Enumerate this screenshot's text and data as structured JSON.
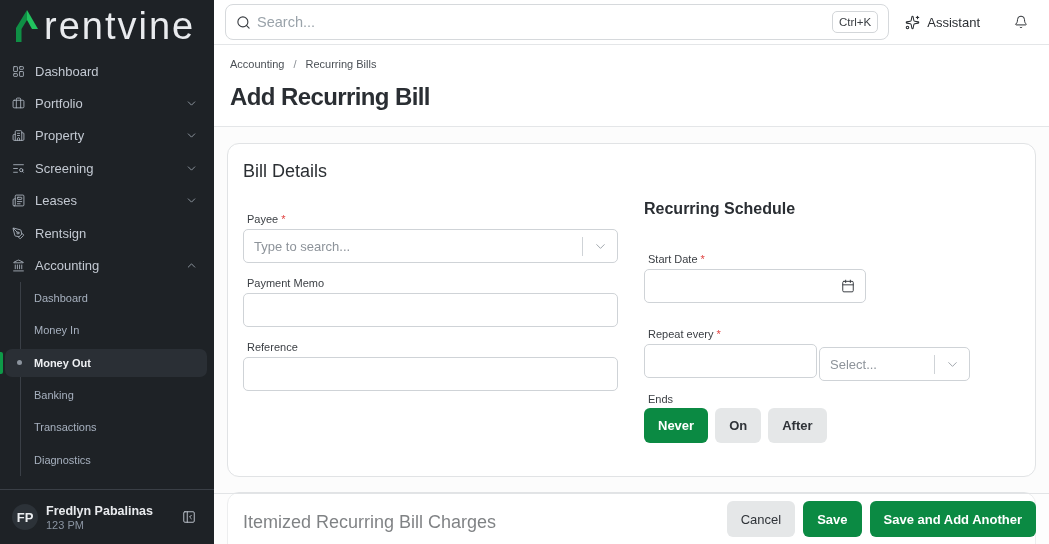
{
  "sidebar": {
    "logo": "rentvine",
    "items": [
      {
        "label": "Dashboard",
        "kind": "link"
      },
      {
        "label": "Portfolio",
        "kind": "group",
        "expanded": false
      },
      {
        "label": "Property",
        "kind": "group",
        "expanded": false
      },
      {
        "label": "Screening",
        "kind": "group",
        "expanded": false
      },
      {
        "label": "Leases",
        "kind": "group",
        "expanded": false
      },
      {
        "label": "Rentsign",
        "kind": "link"
      },
      {
        "label": "Accounting",
        "kind": "group",
        "expanded": true,
        "children": [
          {
            "label": "Dashboard",
            "selected": false
          },
          {
            "label": "Money In",
            "selected": false
          },
          {
            "label": "Money Out",
            "selected": true
          },
          {
            "label": "Banking",
            "selected": false
          },
          {
            "label": "Transactions",
            "selected": false
          },
          {
            "label": "Diagnostics",
            "selected": false
          }
        ]
      }
    ],
    "user": {
      "initials": "FP",
      "name": "Fredlyn Pabalinas",
      "subtitle": "123 PM"
    }
  },
  "top_bar": {
    "search": {
      "placeholder": "Search...",
      "shortcut": "Ctrl+K"
    },
    "assistant": "Assistant"
  },
  "breadcrumb": {
    "items": [
      "Accounting",
      "Recurring Bills"
    ],
    "separator": "/"
  },
  "page_title": "Add Recurring Bill",
  "bill_details": {
    "title": "Bill Details",
    "fields": [
      {
        "label": "Payee",
        "required_mark": "*",
        "kind": "combobox",
        "placeholder": "Type to search..."
      },
      {
        "label": "Payment Memo",
        "kind": "text"
      },
      {
        "label": "Reference",
        "kind": "text"
      }
    ],
    "schedule": {
      "title": "Recurring Schedule",
      "start_date": {
        "label": "Start Date",
        "required_mark": "*"
      },
      "repeat": {
        "label": "Repeat every",
        "required_mark": "*",
        "unit": {
          "placeholder": "Select..."
        }
      },
      "ends": {
        "label": "Ends",
        "options": [
          {
            "label": "Never",
            "selected": true
          },
          {
            "label": "On",
            "selected": false
          },
          {
            "label": "After",
            "selected": false
          }
        ]
      }
    }
  },
  "next_section": {
    "title": "Itemized Recurring Bill Charges"
  },
  "footer": {
    "buttons": [
      {
        "label": "Cancel",
        "kind": "secondary"
      },
      {
        "label": "Save",
        "kind": "primary"
      },
      {
        "label": "Save and Add Another",
        "kind": "primary"
      }
    ]
  }
}
